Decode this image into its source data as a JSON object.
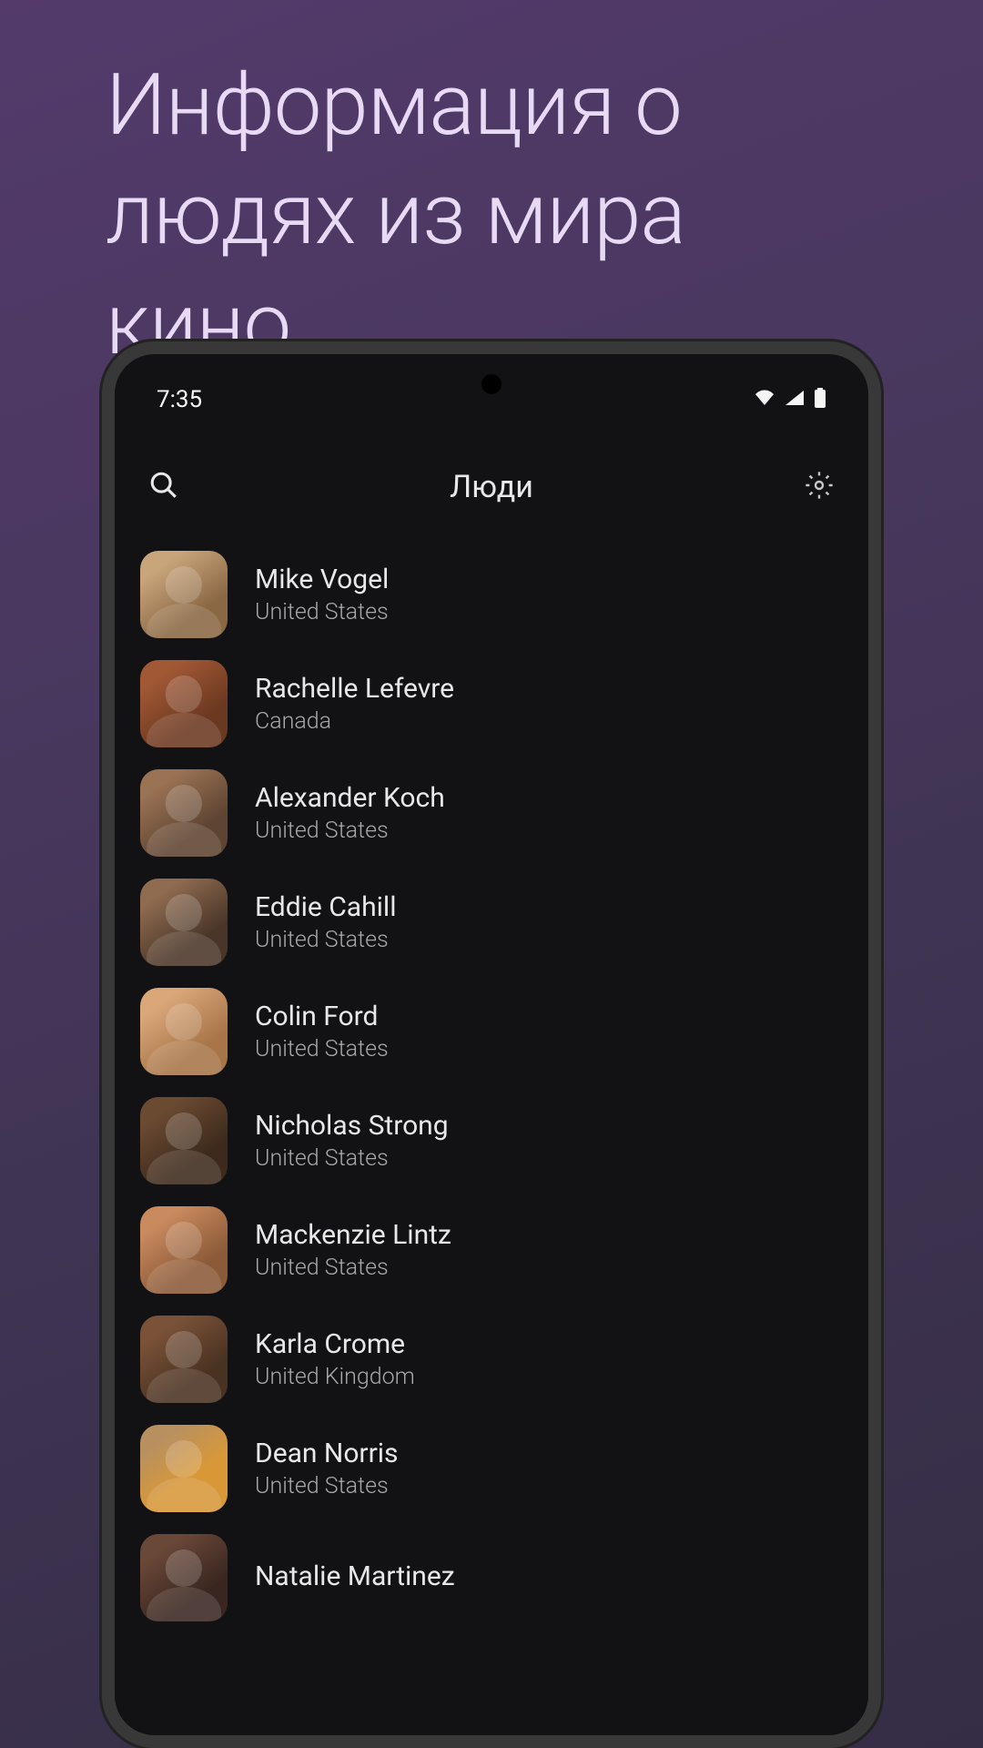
{
  "promo": {
    "heading": "Информация о людях из мира кино"
  },
  "status_bar": {
    "time": "7:35"
  },
  "header": {
    "title": "Люди"
  },
  "people": [
    {
      "name": "Mike Vogel",
      "country": "United States"
    },
    {
      "name": "Rachelle Lefevre",
      "country": "Canada"
    },
    {
      "name": "Alexander Koch",
      "country": "United States"
    },
    {
      "name": "Eddie Cahill",
      "country": "United States"
    },
    {
      "name": "Colin Ford",
      "country": "United States"
    },
    {
      "name": "Nicholas Strong",
      "country": "United States"
    },
    {
      "name": "Mackenzie Lintz",
      "country": "United States"
    },
    {
      "name": "Karla Crome",
      "country": "United Kingdom"
    },
    {
      "name": "Dean Norris",
      "country": "United States"
    },
    {
      "name": "Natalie Martinez",
      "country": ""
    }
  ]
}
